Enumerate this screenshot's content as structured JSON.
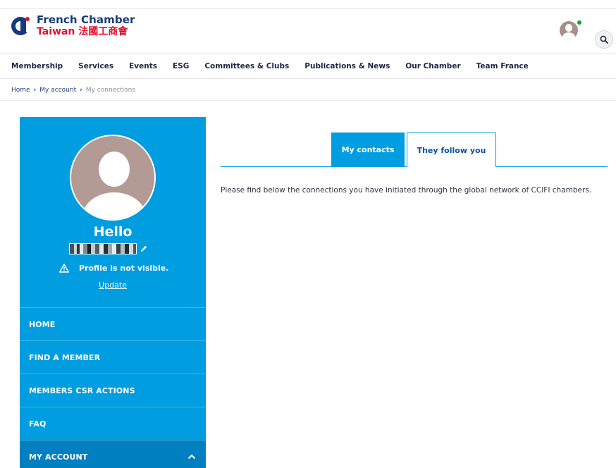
{
  "brand": {
    "line1": "French Chamber",
    "line2": "Taiwan 法國工商會",
    "colors": {
      "navy": "#173a7a",
      "red": "#e4102d",
      "accent": "#009de0"
    }
  },
  "header": {
    "avatar_icon": "user-avatar-icon",
    "status": "online",
    "search_icon": "search-icon"
  },
  "nav": {
    "items": [
      "Membership",
      "Services",
      "Events",
      "ESG",
      "Committees & Clubs",
      "Publications & News",
      "Our Chamber",
      "Team France"
    ]
  },
  "breadcrumb": {
    "home": "Home",
    "account": "My account",
    "current": "My connections"
  },
  "sidebar": {
    "hello": "Hello",
    "visibility_notice": "Profile is not visible.",
    "update_link": "Update",
    "menu": [
      {
        "label": "HOME"
      },
      {
        "label": "FIND A MEMBER"
      },
      {
        "label": "MEMBERS CSR ACTIONS"
      },
      {
        "label": "FAQ"
      },
      {
        "label": "MY ACCOUNT"
      }
    ]
  },
  "main": {
    "tabs": [
      {
        "label": "My contacts",
        "active": true
      },
      {
        "label": "They follow you",
        "active": false
      }
    ],
    "intro": "Please find below the connections you have initiated through the global network of CCIFI chambers."
  }
}
